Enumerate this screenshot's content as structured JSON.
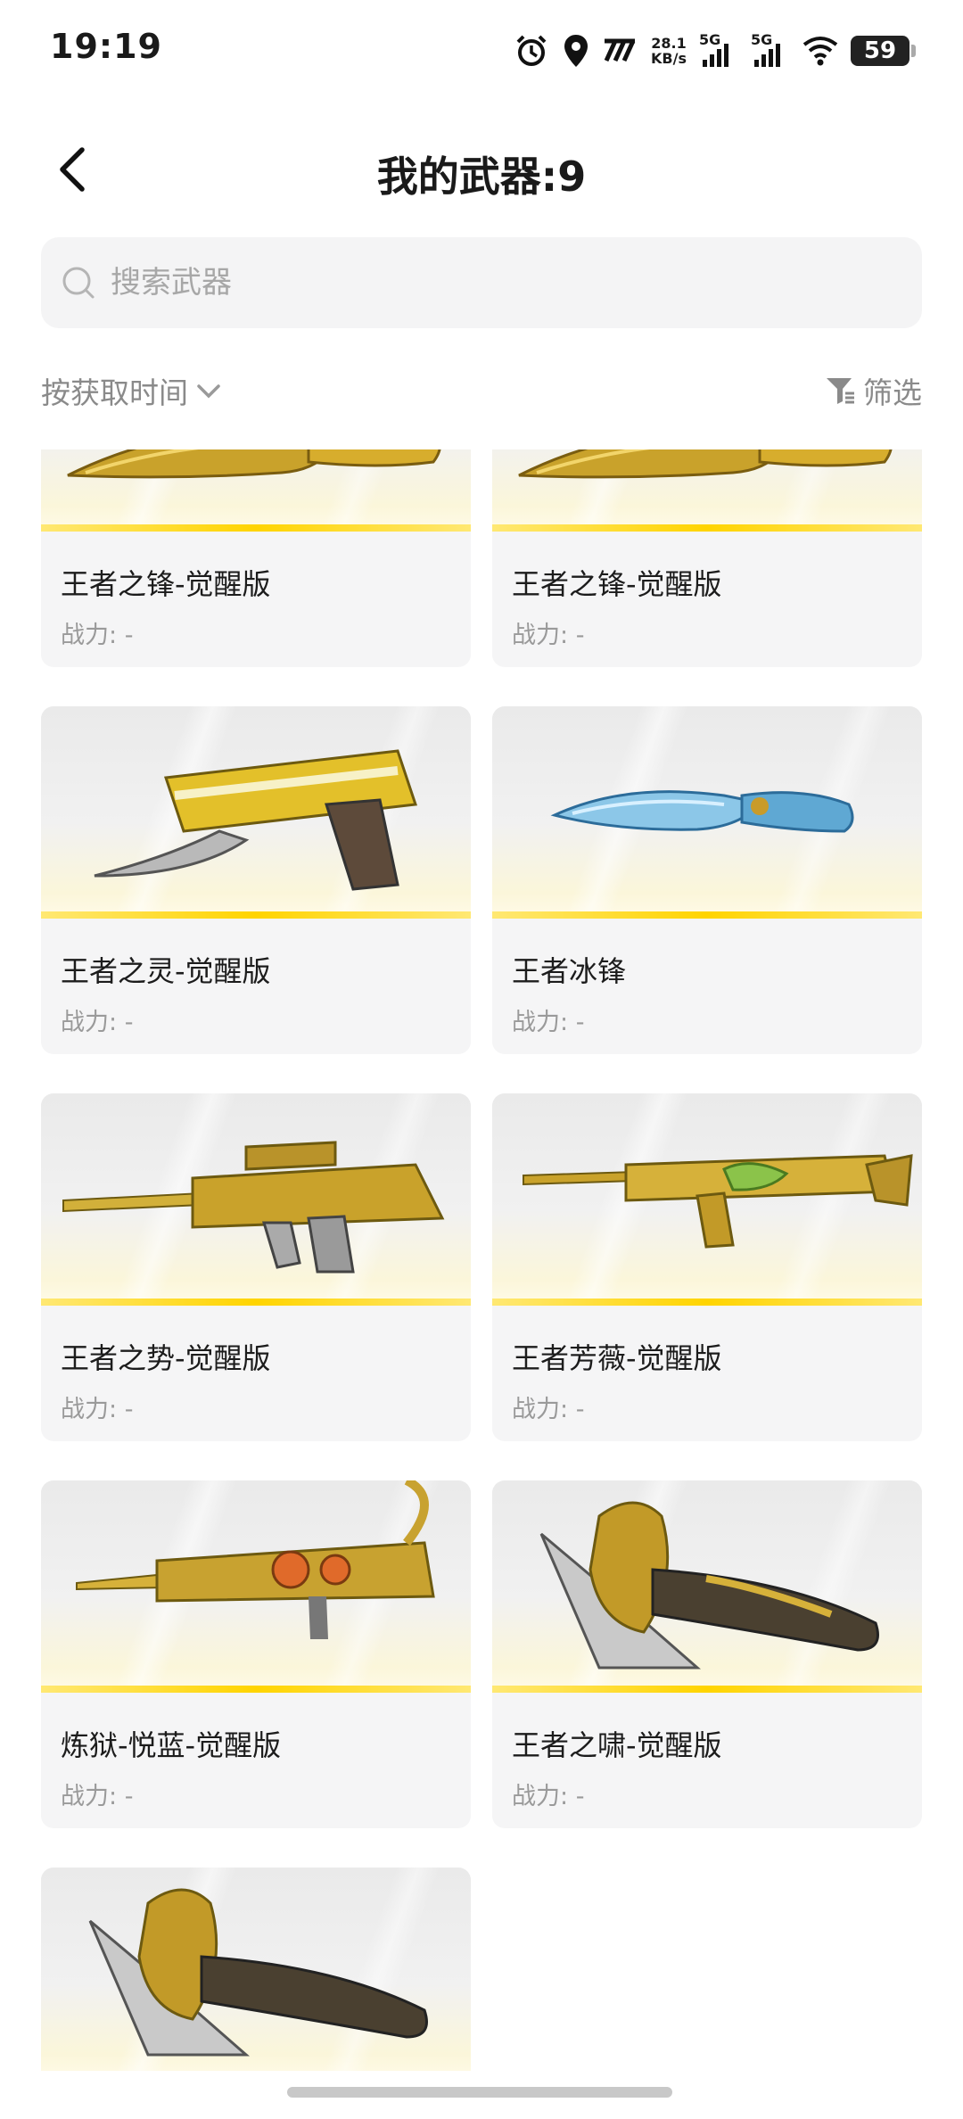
{
  "status_bar": {
    "time": "19:19",
    "net_speed_value": "28.1",
    "net_speed_unit": "KB/s",
    "sim1": "5G",
    "sim2": "5G",
    "battery": "59"
  },
  "header": {
    "title": "我的武器:9"
  },
  "search": {
    "placeholder": "搜索武器"
  },
  "sort": {
    "label": "按获取时间"
  },
  "filter": {
    "label": "筛选"
  },
  "weapons": [
    {
      "name": "王者之锋-觉醒版",
      "power_label": "战力:",
      "power_value": "-"
    },
    {
      "name": "王者之锋-觉醒版",
      "power_label": "战力:",
      "power_value": "-"
    },
    {
      "name": "王者之灵-觉醒版",
      "power_label": "战力:",
      "power_value": "-"
    },
    {
      "name": "王者冰锋",
      "power_label": "战力:",
      "power_value": "-"
    },
    {
      "name": "王者之势-觉醒版",
      "power_label": "战力:",
      "power_value": "-"
    },
    {
      "name": "王者芳薇-觉醒版",
      "power_label": "战力:",
      "power_value": "-"
    },
    {
      "name": "炼狱-悦蓝-觉醒版",
      "power_label": "战力:",
      "power_value": "-"
    },
    {
      "name": "王者之啸-觉醒版",
      "power_label": "战力:",
      "power_value": "-"
    },
    {
      "name": "",
      "power_label": "",
      "power_value": ""
    }
  ]
}
